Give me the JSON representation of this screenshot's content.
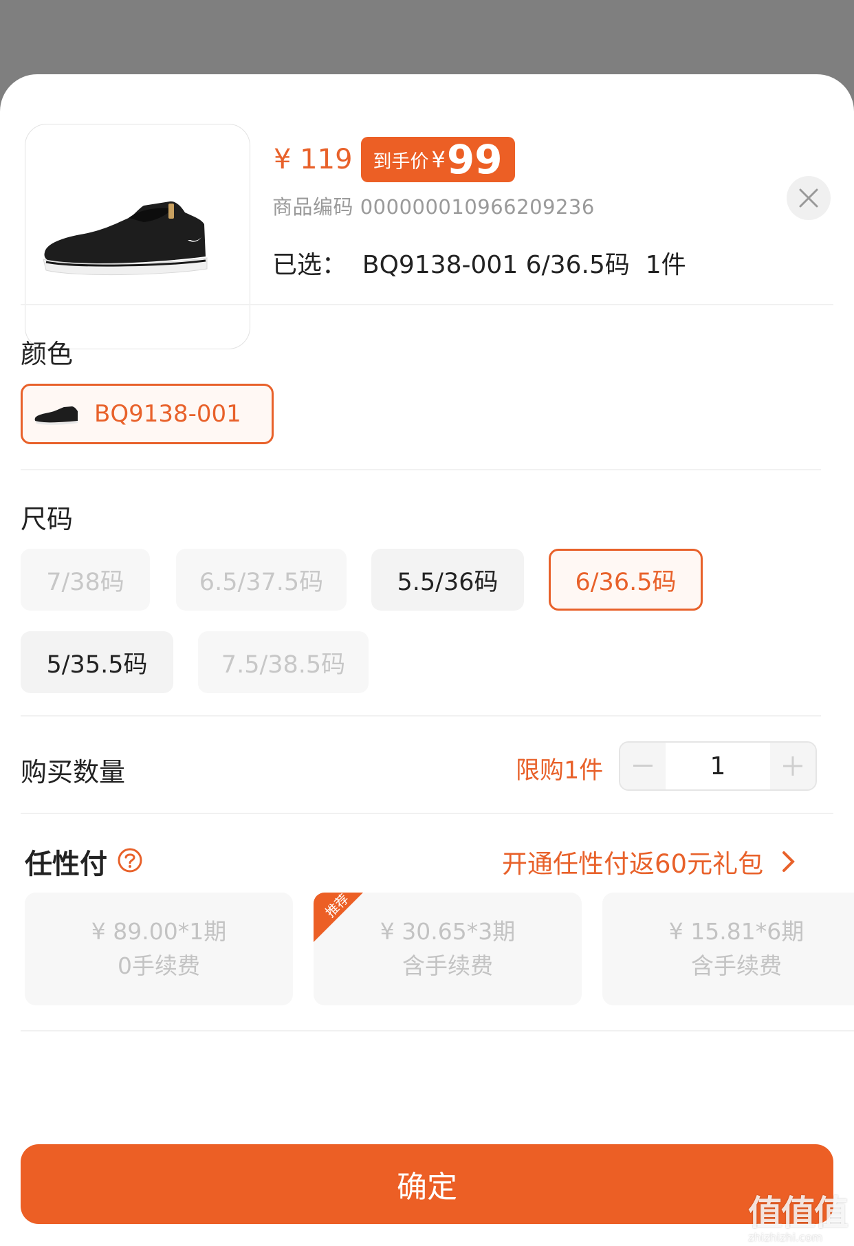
{
  "product": {
    "price": "¥ 119",
    "final_price_label": "到手价",
    "final_price_symbol": "¥",
    "final_price_value": "99",
    "sku_code": "商品编码 000000010966209236",
    "selected_text": "已选：  BQ9138-001 6/36.5码  1件"
  },
  "color_section": {
    "title": "颜色",
    "selected_option": "BQ9138-001"
  },
  "size_section": {
    "title": "尺码",
    "options": [
      {
        "label": "7/38码",
        "state": "disabled"
      },
      {
        "label": "6.5/37.5码",
        "state": "disabled"
      },
      {
        "label": "5.5/36码",
        "state": "available"
      },
      {
        "label": "6/36.5码",
        "state": "selected"
      },
      {
        "label": "5/35.5码",
        "state": "available"
      },
      {
        "label": "7.5/38.5码",
        "state": "disabled"
      }
    ]
  },
  "quantity_section": {
    "title": "购买数量",
    "limit_text": "限购1件",
    "quantity": "1"
  },
  "renxingfu": {
    "title": "任性付",
    "promo_text": "开通任性付返60元礼包",
    "recommend_tag": "推荐",
    "plans": [
      {
        "line1": "¥ 89.00*1期",
        "line2": "0手续费"
      },
      {
        "line1": "¥ 30.65*3期",
        "line2": "含手续费"
      },
      {
        "line1": "¥ 15.81*6期",
        "line2": "含手续费"
      }
    ]
  },
  "confirm_label": "确定",
  "watermark": {
    "big": "值值值",
    "small": "zhizhizhi.com"
  },
  "colors": {
    "accent": "#ec5f25",
    "accent_text": "#e8612a",
    "disabled_text": "#c3c3c3"
  }
}
